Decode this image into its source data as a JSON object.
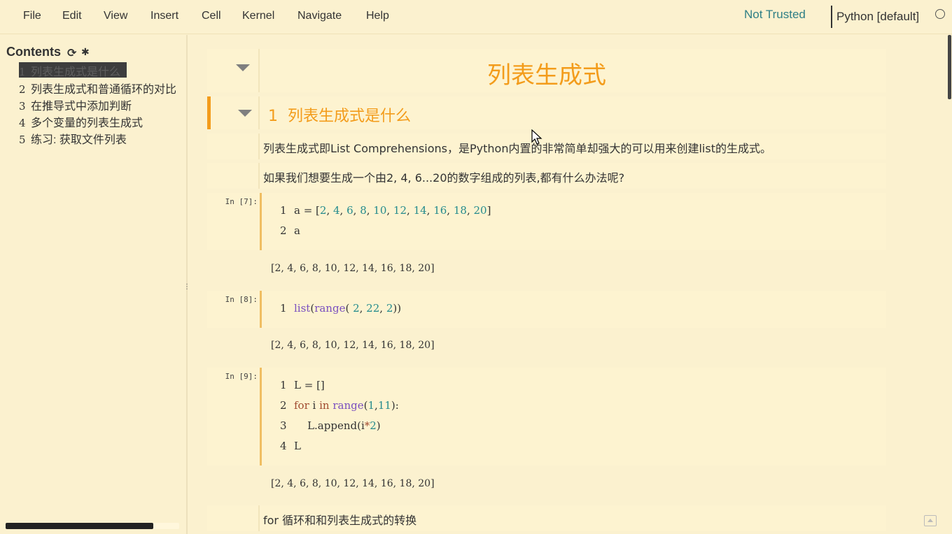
{
  "menu": [
    "File",
    "Edit",
    "View",
    "Insert",
    "Cell",
    "Kernel",
    "Navigate",
    "Help"
  ],
  "trust": "Not Trusted",
  "kernel": "Python [default]",
  "toc": {
    "title": "Contents",
    "items": [
      {
        "num": "1",
        "label": "列表生成式是什么"
      },
      {
        "num": "2",
        "label": "列表生成式和普通循环的对比"
      },
      {
        "num": "3",
        "label": "在推导式中添加判断"
      },
      {
        "num": "4",
        "label": "多个变量的列表生成式"
      },
      {
        "num": "5",
        "label": "练习: 获取文件列表"
      }
    ]
  },
  "notebook": {
    "title": "列表生成式",
    "section1": {
      "num": "1",
      "label": "列表生成式是什么"
    },
    "md1": "列表生成式即List Comprehensions，是Python内置的非常简单却强大的可以用来创建list的生成式。",
    "md2": "如果我们想要生成一个由2, 4, 6...20的数字组成的列表,都有什么办法呢?",
    "cell7": {
      "prompt": "In [7]:",
      "output": "[2, 4, 6, 8, 10, 12, 14, 16, 18, 20]"
    },
    "cell8": {
      "prompt": "In [8]:",
      "output": "[2, 4, 6, 8, 10, 12, 14, 16, 18, 20]"
    },
    "cell9": {
      "prompt": "In [9]:",
      "output": "[2, 4, 6, 8, 10, 12, 14, 16, 18, 20]"
    },
    "md3": "for 循环和和列表生成式的转换"
  }
}
